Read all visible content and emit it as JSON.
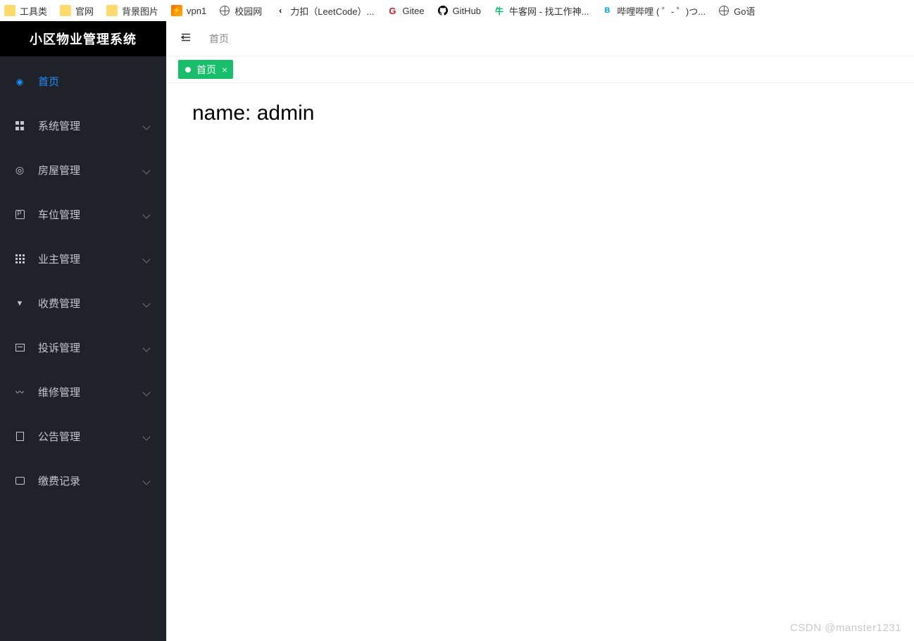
{
  "bookmarks": [
    {
      "label": "工具类",
      "icon": "folder"
    },
    {
      "label": "官网",
      "icon": "folder"
    },
    {
      "label": "背景图片",
      "icon": "folder"
    },
    {
      "label": "vpn1",
      "icon": "vpn"
    },
    {
      "label": "校园网",
      "icon": "globe"
    },
    {
      "label": "力扣（LeetCode）...",
      "icon": "leet"
    },
    {
      "label": "Gitee",
      "icon": "gitee"
    },
    {
      "label": "GitHub",
      "icon": "github"
    },
    {
      "label": "牛客网 - 找工作神...",
      "icon": "nowcoder"
    },
    {
      "label": "哔哩哔哩 (  ゜- ゜)つ...",
      "icon": "bili"
    },
    {
      "label": "Go语",
      "icon": "globe"
    }
  ],
  "app_title": "小区物业管理系统",
  "sidebar": {
    "items": [
      {
        "label": "首页",
        "icon": "dashboard",
        "expandable": false,
        "active": true
      },
      {
        "label": "系统管理",
        "icon": "settings",
        "expandable": true
      },
      {
        "label": "房屋管理",
        "icon": "house",
        "expandable": true
      },
      {
        "label": "车位管理",
        "icon": "parking",
        "expandable": true
      },
      {
        "label": "业主管理",
        "icon": "owner",
        "expandable": true
      },
      {
        "label": "收费管理",
        "icon": "fee",
        "expandable": true
      },
      {
        "label": "投诉管理",
        "icon": "complaint",
        "expandable": true
      },
      {
        "label": "维修管理",
        "icon": "repair",
        "expandable": true
      },
      {
        "label": "公告管理",
        "icon": "notice",
        "expandable": true
      },
      {
        "label": "缴费记录",
        "icon": "record",
        "expandable": true
      }
    ]
  },
  "breadcrumb": "首页",
  "tabs": [
    {
      "label": "首页",
      "active": true
    }
  ],
  "content_text": "name: admin",
  "watermark": "CSDN @manster1231"
}
